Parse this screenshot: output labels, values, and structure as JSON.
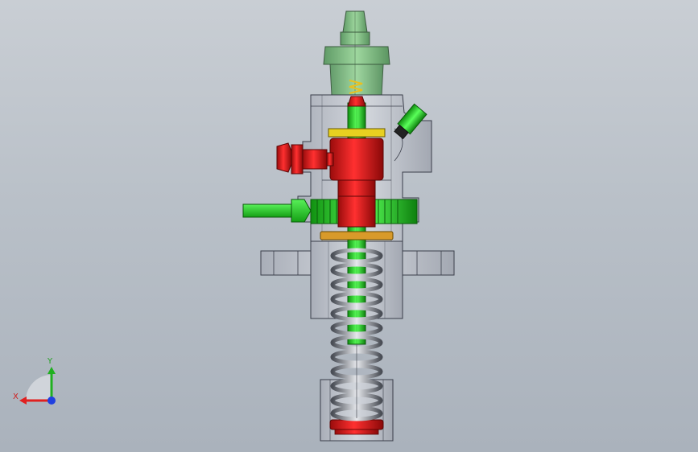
{
  "view": {
    "background_top": "#c9ced4",
    "background_bottom": "#aab2bc"
  },
  "triad": {
    "x_label": "X",
    "y_label": "Y",
    "x_color": "#e02020",
    "y_color": "#20b020",
    "z_color": "#2040e0"
  },
  "parts": {
    "colors": {
      "housing": "#c8ccd2",
      "housing_edge": "#3a3e4a",
      "red": "#e01818",
      "green": "#2ee82e",
      "transparent_green": "#7ec27e",
      "yellow": "#e8d020",
      "orange": "#d89a2a",
      "spring": "#8a8e96"
    }
  }
}
